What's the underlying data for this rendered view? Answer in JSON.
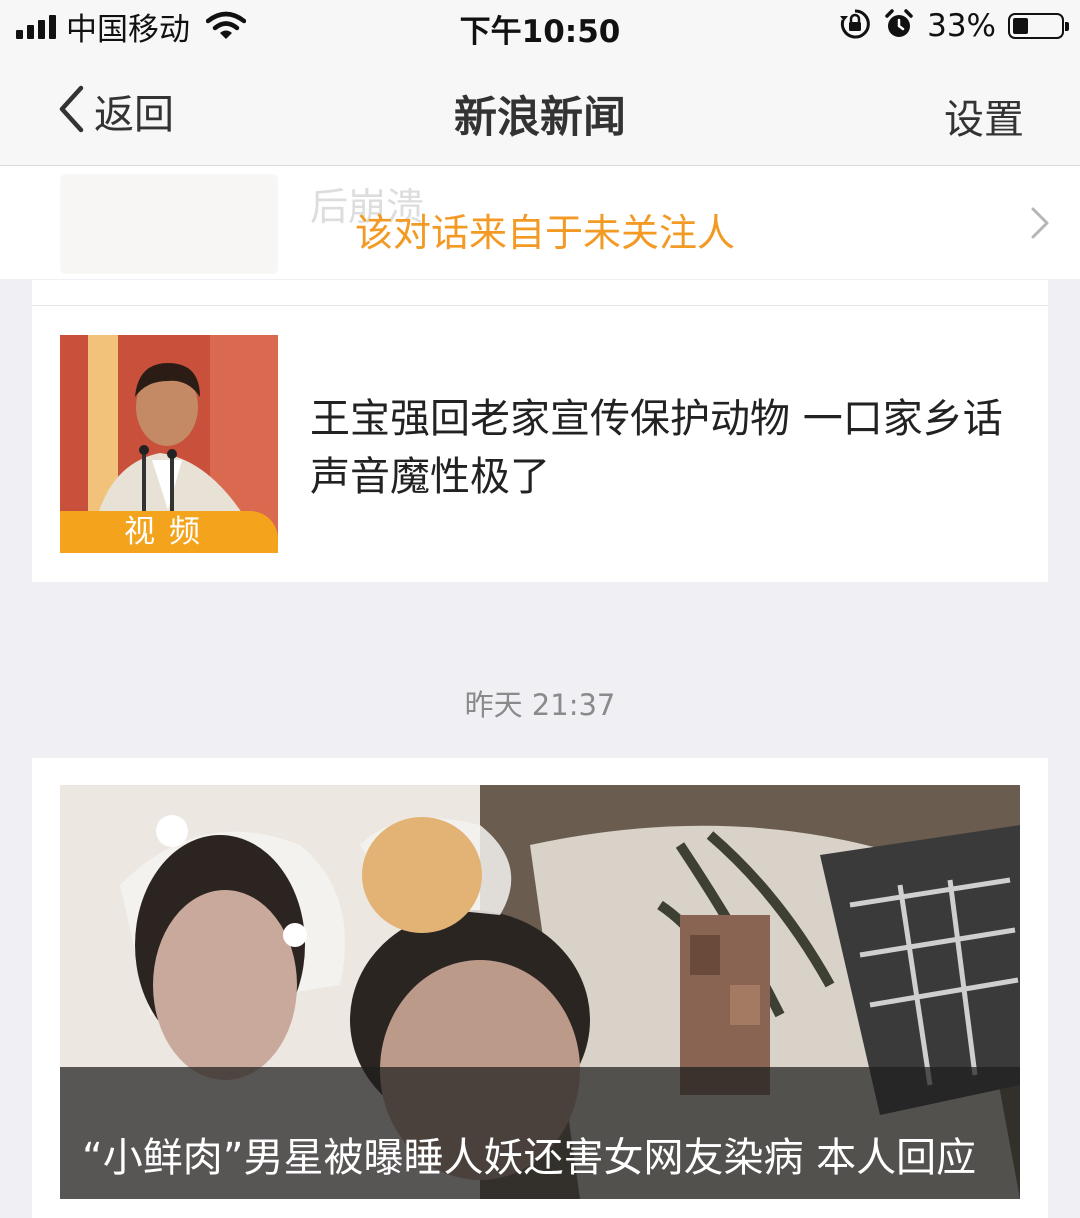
{
  "status_bar": {
    "carrier": "中国移动",
    "time": "下午10:50",
    "battery_percent": "33%",
    "battery_level": 0.33,
    "icons": [
      "signal-icon",
      "wifi-icon",
      "rotation-lock-icon",
      "alarm-icon",
      "battery-icon"
    ]
  },
  "nav": {
    "back_label": "返回",
    "title": "新浪新闻",
    "settings_label": "设置"
  },
  "notice": {
    "ghost_text": "后崩溃",
    "text": "该对话来自于未关注人",
    "color": "#f29a24"
  },
  "messages": [
    {
      "type": "news-small",
      "thumbnail_tag": "视频",
      "headline": "王宝强回老家宣传保护动物 一口家乡话声音魔性极了"
    },
    {
      "timestamp": "昨天 21:37"
    },
    {
      "type": "news-large",
      "headline": "“小鲜肉”男星被曝睡人妖还害女网友染病 本人回应"
    }
  ],
  "colors": {
    "accent_orange": "#f29a24",
    "video_tag": "#f3a41c",
    "background": "#efeff4"
  }
}
